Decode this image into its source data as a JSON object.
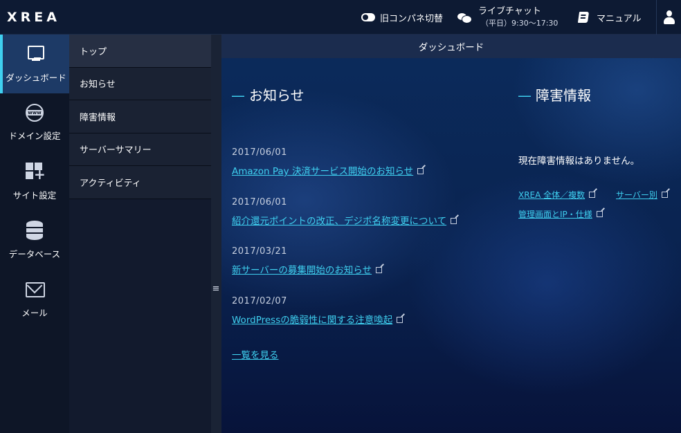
{
  "header": {
    "logo": "XREA",
    "toggle_label": "旧コンパネ切替",
    "chat_label": "ライブチャット",
    "chat_hours": "（平日）9:30～17:30",
    "manual_label": "マニュアル"
  },
  "leftnav": [
    {
      "label": "ダッシュボード",
      "icon": "monitor-icon",
      "active": true
    },
    {
      "label": "ドメイン設定",
      "icon": "www-globe-icon"
    },
    {
      "label": "サイト設定",
      "icon": "grid-plus-icon"
    },
    {
      "label": "データベース",
      "icon": "database-icon"
    },
    {
      "label": "メール",
      "icon": "mail-icon"
    }
  ],
  "subnav": [
    {
      "label": "トップ",
      "active": true
    },
    {
      "label": "お知らせ"
    },
    {
      "label": "障害情報"
    },
    {
      "label": "サーバーサマリー"
    },
    {
      "label": "アクティビティ"
    }
  ],
  "main": {
    "title": "ダッシュボード",
    "news": {
      "dash": "—",
      "title": "お知らせ",
      "items": [
        {
          "date": "2017/06/01",
          "text": "Amazon Pay 決済サービス開始のお知らせ"
        },
        {
          "date": "2017/06/01",
          "text": "紹介還元ポイントの改正、デジポ名称変更について"
        },
        {
          "date": "2017/03/21",
          "text": "新サーバーの募集開始のお知らせ"
        },
        {
          "date": "2017/02/07",
          "text": "WordPressの脆弱性に関する注意喚起"
        }
      ],
      "more": "一覧を見る"
    },
    "incidents": {
      "dash": "—",
      "title": "障害情報",
      "status": "現在障害情報はありません。",
      "links": [
        "XREA 全体／複数",
        "サーバー別",
        "管理画面とIP・仕様"
      ]
    }
  },
  "colors": {
    "accent": "#3fd0f0",
    "topbar": "#0d1a33",
    "nav_active": "#1d3a66"
  }
}
